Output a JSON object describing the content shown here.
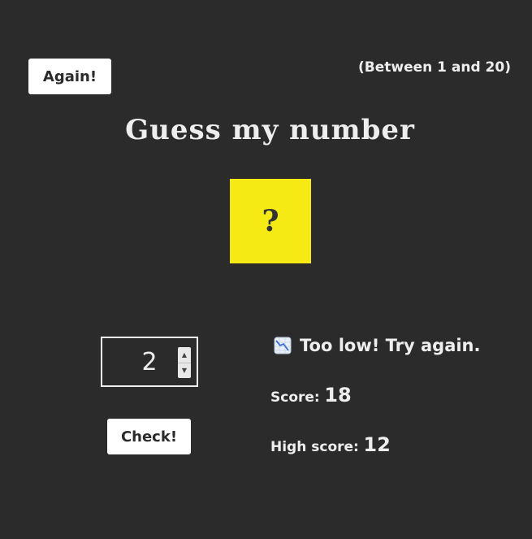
{
  "header": {
    "again_label": "Again!",
    "range_text": "(Between 1 and 20)"
  },
  "title": "Guess my number",
  "secret": {
    "display": "?",
    "box_color": "#f5ea14"
  },
  "guess": {
    "value": "2"
  },
  "check_label": "Check!",
  "message": {
    "icon": "chart-decreasing-icon",
    "text": "Too low! Try again."
  },
  "score": {
    "label": "Score:",
    "value": "18"
  },
  "highscore": {
    "label": "High score:",
    "value": "12"
  },
  "colors": {
    "background": "#2b2b2b",
    "text": "#eeeeee",
    "accent": "#f5ea14"
  }
}
